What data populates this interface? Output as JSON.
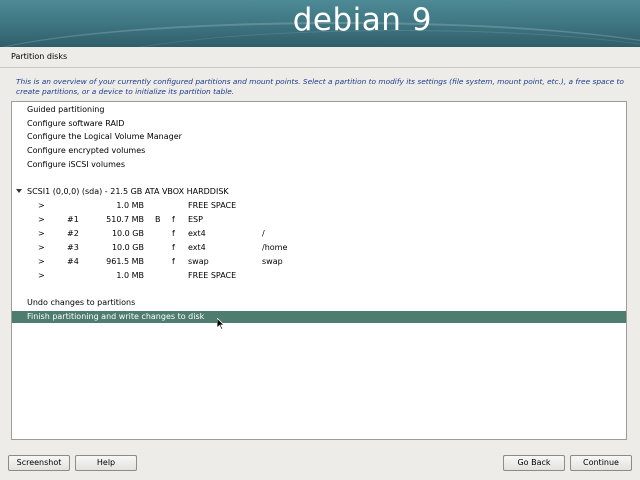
{
  "banner": {
    "logo_text": "debian 9"
  },
  "header": {
    "title": "Partition disks"
  },
  "description": "This is an overview of your currently configured partitions and mount points. Select a partition to modify its settings (file system, mount point, etc.), a free space to create partitions, or a device to initialize its partition table.",
  "menu_items": [
    {
      "label": "Guided partitioning"
    },
    {
      "label": "Configure software RAID"
    },
    {
      "label": "Configure the Logical Volume Manager"
    },
    {
      "label": "Configure encrypted volumes"
    },
    {
      "label": "Configure iSCSI volumes"
    }
  ],
  "disk": {
    "label": "SCSI1 (0,0,0) (sda) - 21.5 GB ATA VBOX HARDDISK"
  },
  "partitions": [
    {
      "arrow": ">",
      "num": "",
      "size": "1.0 MB",
      "boot": "",
      "format": "",
      "type": "FREE SPACE",
      "mount": ""
    },
    {
      "arrow": ">",
      "num": "#1",
      "size": "510.7 MB",
      "boot": "B",
      "format": "f",
      "type": "ESP",
      "mount": ""
    },
    {
      "arrow": ">",
      "num": "#2",
      "size": "10.0 GB",
      "boot": "",
      "format": "f",
      "type": "ext4",
      "mount": "/"
    },
    {
      "arrow": ">",
      "num": "#3",
      "size": "10.0 GB",
      "boot": "",
      "format": "f",
      "type": "ext4",
      "mount": "/home"
    },
    {
      "arrow": ">",
      "num": "#4",
      "size": "961.5 MB",
      "boot": "",
      "format": "f",
      "type": "swap",
      "mount": "swap"
    },
    {
      "arrow": ">",
      "num": "",
      "size": "1.0 MB",
      "boot": "",
      "format": "",
      "type": "FREE SPACE",
      "mount": ""
    }
  ],
  "actions": [
    {
      "label": "Undo changes to partitions"
    },
    {
      "label": "Finish partitioning and write changes to disk",
      "selected": true
    }
  ],
  "buttons": {
    "screenshot": "Screenshot",
    "help": "Help",
    "go_back": "Go Back",
    "continue": "Continue"
  },
  "colors": {
    "selection": "#4e7c6f",
    "description_text": "#1b3d8a",
    "banner": "#3d7480"
  }
}
